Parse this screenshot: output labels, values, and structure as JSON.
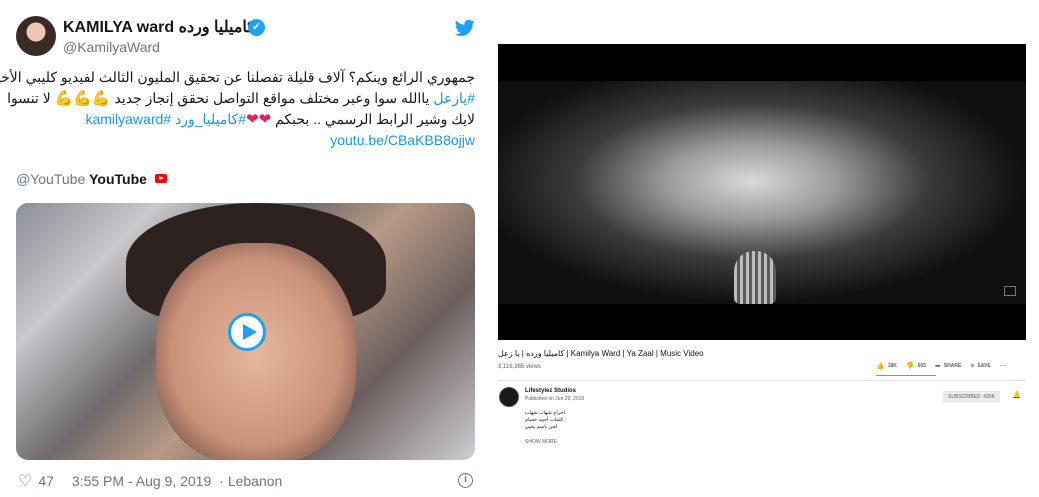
{
  "tweet": {
    "display_name": "KAMILYA ward كاميليا ورده",
    "handle": "@KamilyaWard",
    "text_lines": [
      "جمهوري الرائع وينكم؟ آلاف قليلة تفصلنا عن تحقيق المليون الثالث لفيديو كليبي الأخير",
      "#يازعل ياالله سوا وعبر مختلف مواقع التواصل نحقق إنجاز جديد 💪💪💪 لا تنسوا",
      "لايك وشير الرابط الرسمي .. بحبكم ❤️❤️#كاميليا_ورد #kamilyaward"
    ],
    "hashtag_yazaal": "#يازعل",
    "hashtag_kamilya": "#كاميليا_ورد",
    "hashtag_kamilyaward": "#kamilyaward",
    "line2_rest": " ياالله سوا وعبر مختلف مواقع التواصل نحقق إنجاز جديد ",
    "line2_end": " لا تنسوا",
    "line3_start": "لايك وشير الرابط الرسمي .. بحبكم ",
    "flex_emoji": "💪💪💪",
    "hearts": "❤❤",
    "url": "youtu.be/CBaKBB8ojjw",
    "quoted_handle": "@YouTube",
    "quoted_name": "YouTube",
    "likes": "47",
    "timestamp": "3:55 PM - Aug 9, 2019",
    "location": "Lebanon",
    "separator": "·"
  },
  "youtube": {
    "title": "كاميليا ورده | يا زعل | Kamilya Ward | Ya Zaal | Music Video",
    "views": "3,116,365 views",
    "likes": "18K",
    "dislikes": "603",
    "share_label": "SHARE",
    "save_label": "SAVE",
    "channel": "Lifestylez Studios",
    "published": "Published on Jun 29, 2019",
    "subscribe_label": "SUBSCRIBED",
    "subscriber_count": "439K",
    "description_lines": [
      "اخراج شهاب شهاب",
      "كلمات أحمد حسام",
      "لحن باسم يحيى"
    ],
    "show_more": "SHOW MORE"
  },
  "colors": {
    "link": "#1b95e0",
    "twitter_blue": "#1da1f2",
    "heart": "#e0245e",
    "yt_red": "#ff0000"
  },
  "icons": [
    "verified-icon",
    "twitter-bird-icon",
    "youtube-logo-icon",
    "play-icon",
    "heart-outline-icon",
    "info-icon",
    "thumb-up-icon",
    "thumb-down-icon",
    "share-icon",
    "save-icon",
    "bell-icon"
  ]
}
